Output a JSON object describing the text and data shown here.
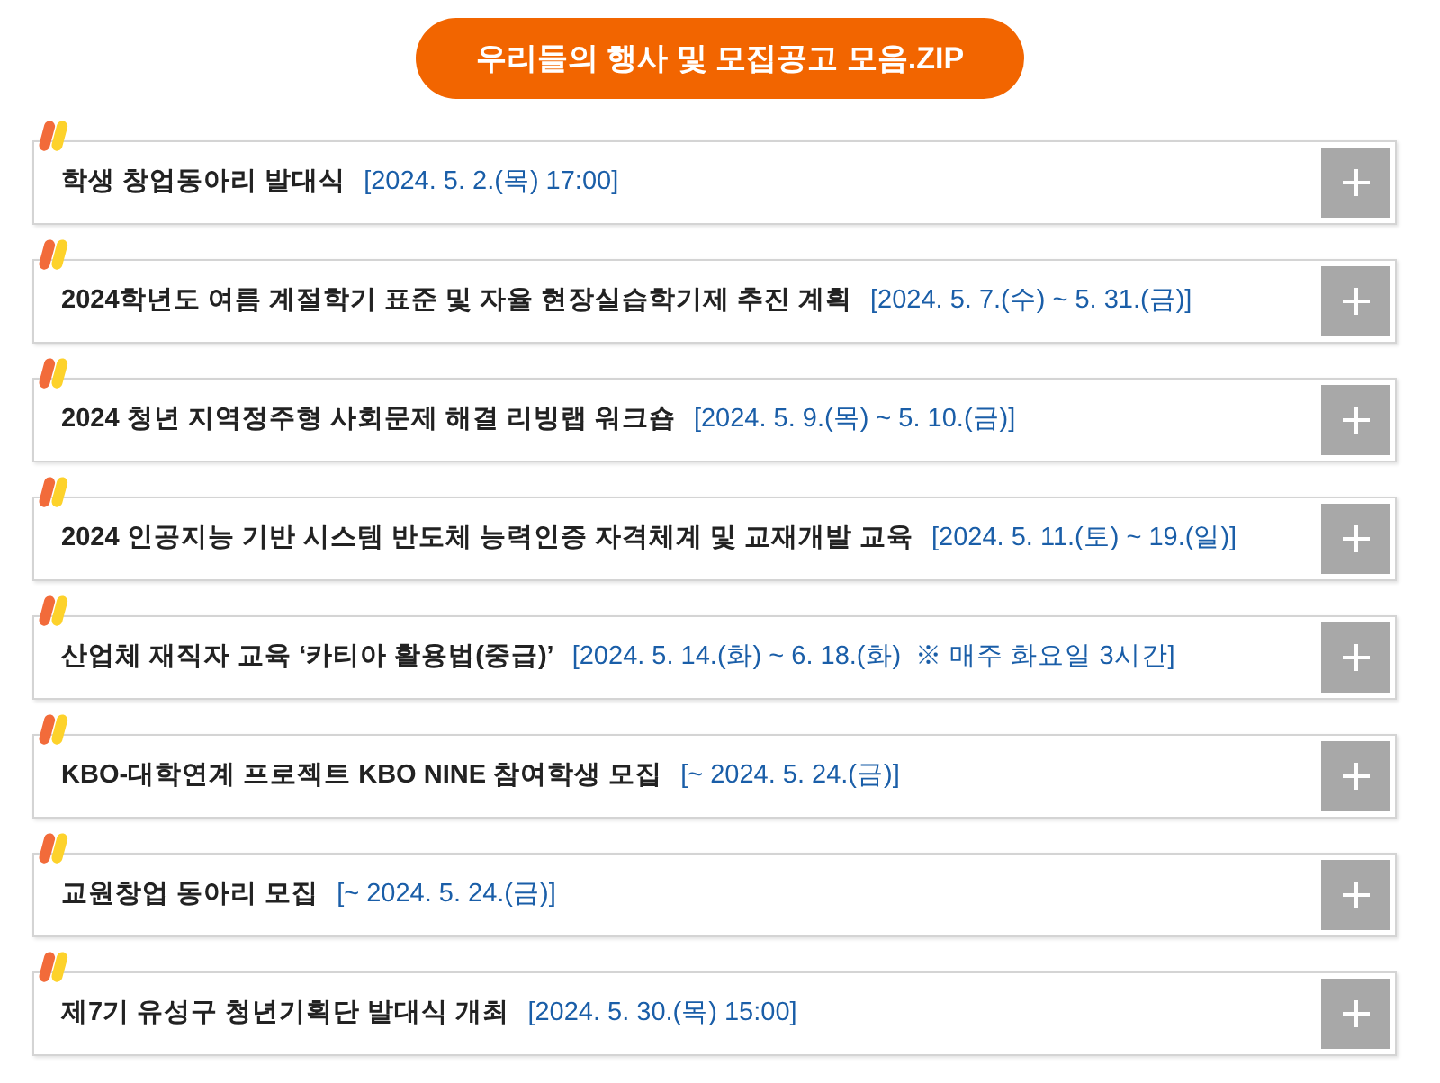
{
  "header": {
    "title": "우리들의 행사 및 모집공고 모음.ZIP"
  },
  "items": [
    {
      "title": "학생 창업동아리 발대식",
      "date": "[2024. 5. 2.(목) 17:00]"
    },
    {
      "title": "2024학년도 여름 계절학기 표준 및 자율 현장실습학기제 추진 계획",
      "date": "[2024. 5. 7.(수) ~ 5. 31.(금)]"
    },
    {
      "title": "2024 청년 지역정주형 사회문제 해결 리빙랩 워크숍",
      "date": "[2024. 5. 9.(목) ~ 5. 10.(금)]"
    },
    {
      "title": "2024 인공지능 기반 시스템 반도체 능력인증 자격체계 및 교재개발 교육",
      "date": "[2024. 5. 11.(토) ~ 19.(일)]"
    },
    {
      "title": "산업체 재직자 교육 ‘카티아 활용법(중급)’",
      "date": "[2024. 5. 14.(화) ~ 6. 18.(화)  ※ 매주 화요일 3시간]"
    },
    {
      "title": "KBO-대학연계 프로젝트 KBO NINE 참여학생 모집",
      "date": "[~ 2024. 5. 24.(금)]"
    },
    {
      "title": "교원창업 동아리 모집",
      "date": "[~ 2024. 5. 24.(금)]"
    },
    {
      "title": "제7기 유성구 청년기획단 발대식 개최",
      "date": "[2024. 5. 30.(목) 15:00]"
    }
  ]
}
